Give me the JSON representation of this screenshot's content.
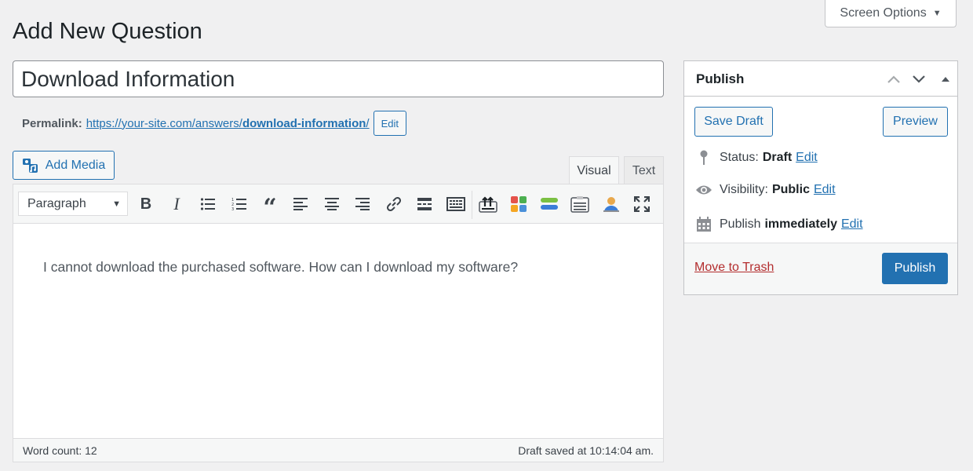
{
  "header": {
    "screen_options_label": "Screen Options",
    "page_title": "Add New Question"
  },
  "post": {
    "title_value": "Download Information",
    "permalink_label": "Permalink:",
    "permalink_base": "https://your-site.com/answers/",
    "permalink_slug": "download-information",
    "permalink_trailing": "/",
    "permalink_edit_label": "Edit"
  },
  "editor": {
    "add_media_label": "Add Media",
    "tabs": [
      {
        "label": "Visual",
        "active": true
      },
      {
        "label": "Text",
        "active": false
      }
    ],
    "format_select_value": "Paragraph",
    "toolbar_icons": [
      "bold-icon",
      "italic-icon",
      "bullet-list-icon",
      "numbered-list-icon",
      "blockquote-icon",
      "align-left-icon",
      "align-center-icon",
      "align-right-icon",
      "link-icon",
      "read-more-icon",
      "toolbar-toggle-icon",
      "plugin-upload-icon",
      "plugin-grid-icon",
      "plugin-layers-icon",
      "plugin-notepad-icon",
      "plugin-user-icon",
      "fullscreen-icon"
    ],
    "content": "I cannot download the purchased software. How can I download my software?",
    "word_count": "Word count: 12",
    "draft_saved": "Draft saved at 10:14:04 am."
  },
  "publish": {
    "title": "Publish",
    "save_draft_label": "Save Draft",
    "preview_label": "Preview",
    "status_label": "Status:",
    "status_value": "Draft",
    "visibility_label": "Visibility:",
    "visibility_value": "Public",
    "schedule_label": "Publish",
    "schedule_value": "immediately",
    "edit_label": "Edit",
    "trash_label": "Move to Trash",
    "publish_label": "Publish"
  },
  "colors": {
    "accent": "#2271b1",
    "danger": "#b32d2e",
    "background": "#f0f0f1"
  }
}
